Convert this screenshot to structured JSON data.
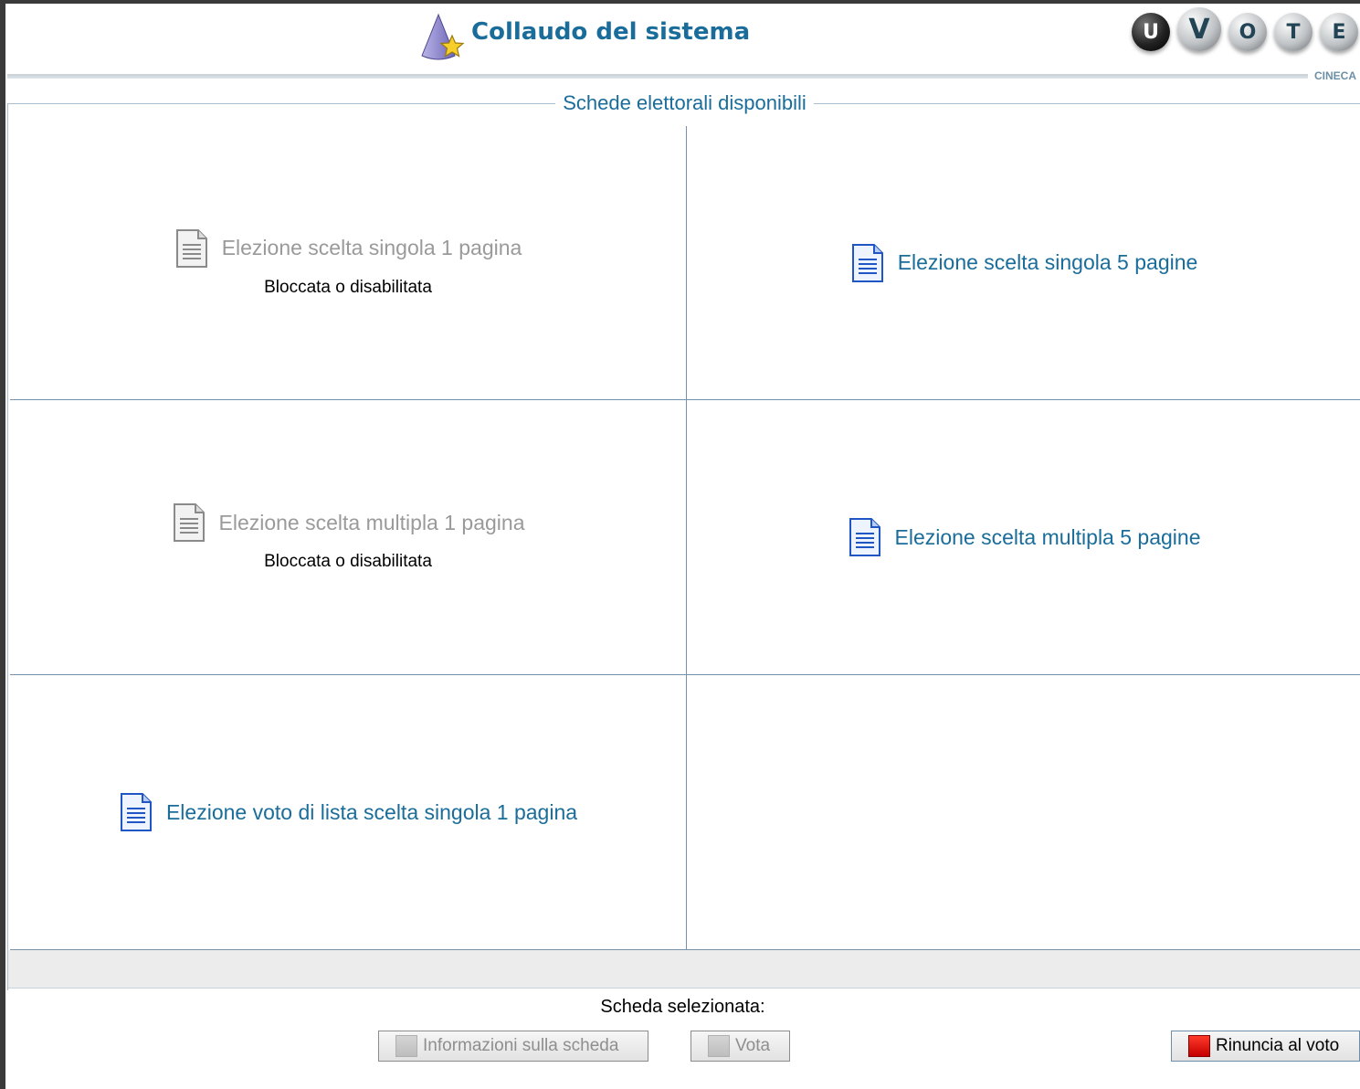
{
  "header": {
    "title": "Collaudo del sistema",
    "logo_letters": [
      "U",
      "V",
      "O",
      "T",
      "E"
    ],
    "brand": "CINECA"
  },
  "ballots": {
    "legend": "Schede elettorali disponibili",
    "items": [
      {
        "label": "Elezione scelta singola 1 pagina",
        "enabled": false,
        "status": "Bloccata o disabilitata"
      },
      {
        "label": "Elezione scelta singola 5 pagine",
        "enabled": true
      },
      {
        "label": "Elezione scelta multipla 1 pagina",
        "enabled": false,
        "status": "Bloccata o disabilitata"
      },
      {
        "label": "Elezione scelta multipla 5 pagine",
        "enabled": true
      },
      {
        "label": "Elezione voto di lista scelta singola 1 pagina",
        "enabled": true
      }
    ]
  },
  "footer": {
    "selected_label": "Scheda selezionata:",
    "info_button": "Informazioni sulla scheda",
    "vote_button": "Vota",
    "withdraw_button": "Rinuncia al voto"
  },
  "colors": {
    "accent": "#1a6d9a",
    "disabled_text": "#9a9a9a",
    "grid_line": "#7792a8"
  },
  "icons": {
    "title": "cone-star-icon",
    "ballot_enabled": "document-blue-icon",
    "ballot_disabled": "document-gray-icon",
    "withdraw": "red-square-icon"
  }
}
